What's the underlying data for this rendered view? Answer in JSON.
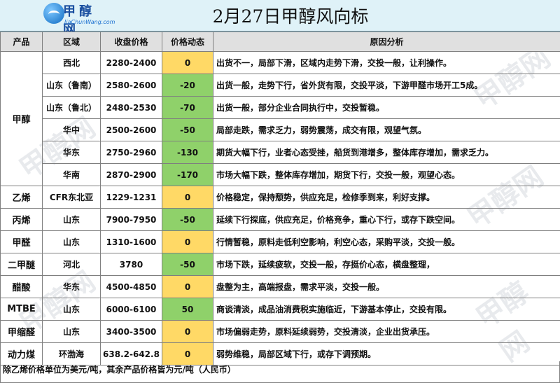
{
  "logo": {
    "cn": "甲醇网",
    "en": "JiaChunWang.com"
  },
  "title": "2月27日甲醇风向标",
  "watermark": "甲醇网",
  "headers": {
    "product": "产品",
    "region": "区域",
    "price": "收盘价格",
    "change": "价格动态",
    "reason": "原因分析"
  },
  "product_groups": [
    {
      "name": "甲醇",
      "rows": [
        {
          "region": "西北",
          "price": "2280-2400",
          "change": "0",
          "reason": "出货不一，局部下滑，区域内走势下滑，交投一般，让利操作。"
        },
        {
          "region": "山东（鲁南）",
          "price": "2580-2600",
          "change": "-20",
          "reason": "出货一般，走势下行，省外货有限，交投平淡，下游甲醛市场开工5成。"
        },
        {
          "region": "山东（鲁北）",
          "price": "2480-2530",
          "change": "-70",
          "reason": "出货一般，部分企业合同执行中，交投暂稳。"
        },
        {
          "region": "华中",
          "price": "2500-2600",
          "change": "-50",
          "reason": "局部走跌，需求乏力，弱势震荡，成交有限，观望气氛。"
        },
        {
          "region": "华东",
          "price": "2750-2960",
          "change": "-130",
          "reason": "期货大幅下行，业者心态受挫，船货到港增多，整体库存增加，需求乏力。"
        },
        {
          "region": "华南",
          "price": "2870-2900",
          "change": "-170",
          "reason": "市场大幅下跌，整体库存增加，期货下行，交投一般，观望心态。"
        }
      ]
    },
    {
      "name": "乙烯",
      "rows": [
        {
          "region": "CFR东北亚",
          "price": "1229-1231",
          "change": "0",
          "reason": "价格稳定，保持颓势，供应充足，检修季到来，利好支撑。"
        }
      ]
    },
    {
      "name": "丙烯",
      "rows": [
        {
          "region": "山东",
          "price": "7900-7950",
          "change": "-50",
          "reason": "延续下行探底，供应充足，价格竞争，重心下行，或存下跌空间。"
        }
      ]
    },
    {
      "name": "甲醛",
      "rows": [
        {
          "region": "山东",
          "price": "1310-1600",
          "change": "0",
          "reason": "行情暂稳，原料走低利空影响，利空心态，采购平淡，交投一般。"
        }
      ]
    },
    {
      "name": "二甲醚",
      "rows": [
        {
          "region": "河北",
          "price": "3780",
          "change": "-50",
          "reason": "市场下跌，延续疲软，交投一般，存挺价心态，横盘整理，"
        }
      ]
    },
    {
      "name": "醋酸",
      "rows": [
        {
          "region": "华东",
          "price": "4500-4850",
          "change": "0",
          "reason": "盘整为主，高端报盘，需求平淡，交投一般。"
        }
      ]
    },
    {
      "name": "MTBE",
      "rows": [
        {
          "region": "山东",
          "price": "6000-6100",
          "change": "50",
          "reason": "商谈清淡，成品油消费税实施临近，下游基本停止，交投有限。"
        }
      ]
    },
    {
      "name": "甲缩醛",
      "rows": [
        {
          "region": "山东",
          "price": "3400-3500",
          "change": "0",
          "reason": "市场偏弱走势，原料延续弱势，交投清淡，企业出货承压。"
        }
      ]
    },
    {
      "name": "动力煤",
      "rows": [
        {
          "region": "环渤海",
          "price": "638.2-642.8",
          "change": "0",
          "reason": "弱势维稳，局部区域下行，或存下调预期。"
        }
      ]
    }
  ],
  "footnote": "除乙烯价格单位为美元/吨，其余产品价格皆为元/吨（人民币）",
  "colors": {
    "up_down": "#8fd16a",
    "flat": "#ffd966",
    "header_bg": "#e0e0e0"
  }
}
